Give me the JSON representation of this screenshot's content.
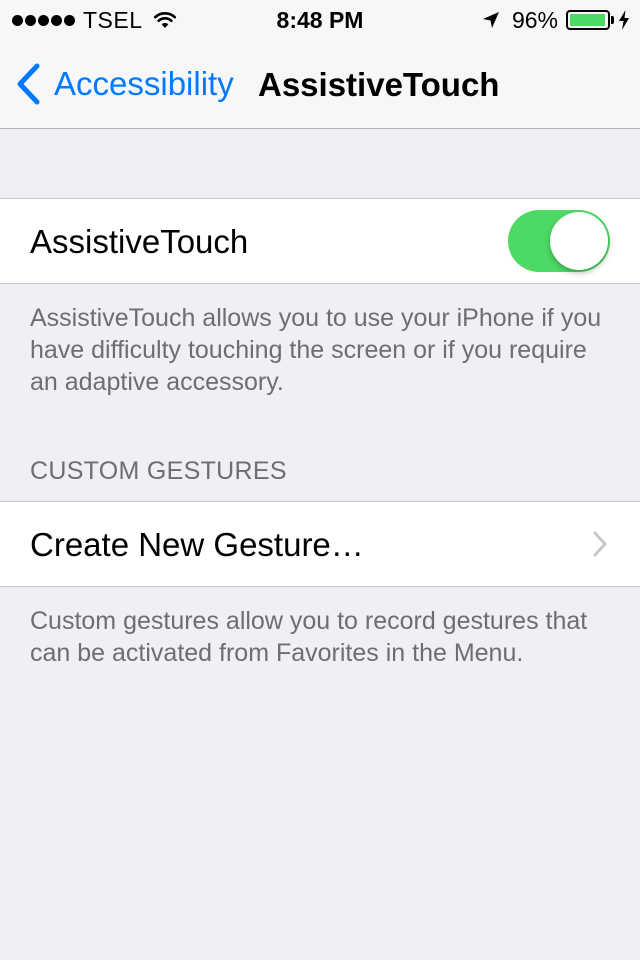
{
  "status_bar": {
    "carrier": "TSEL",
    "time": "8:48 PM",
    "battery_percent": "96%",
    "battery_level": 0.96,
    "signal_bars": 5,
    "accent_color": "#4cd964"
  },
  "nav": {
    "back_label": "Accessibility",
    "title": "AssistiveTouch",
    "tint_color": "#007aff"
  },
  "assistive_touch": {
    "label": "AssistiveTouch",
    "enabled": true,
    "description": "AssistiveTouch allows you to use your iPhone if you have difficulty touching the screen or if you require an adaptive accessory."
  },
  "custom_gestures": {
    "header": "CUSTOM GESTURES",
    "create_label": "Create New Gesture…",
    "description": "Custom gestures allow you to record gestures that can be activated from Favorites in the Menu."
  },
  "icons": {
    "signal": "signal-dots-icon",
    "wifi": "wifi-icon",
    "location": "location-arrow-icon",
    "battery": "battery-icon",
    "charging": "charging-bolt-icon",
    "back": "chevron-left-icon",
    "disclosure": "chevron-right-icon"
  }
}
